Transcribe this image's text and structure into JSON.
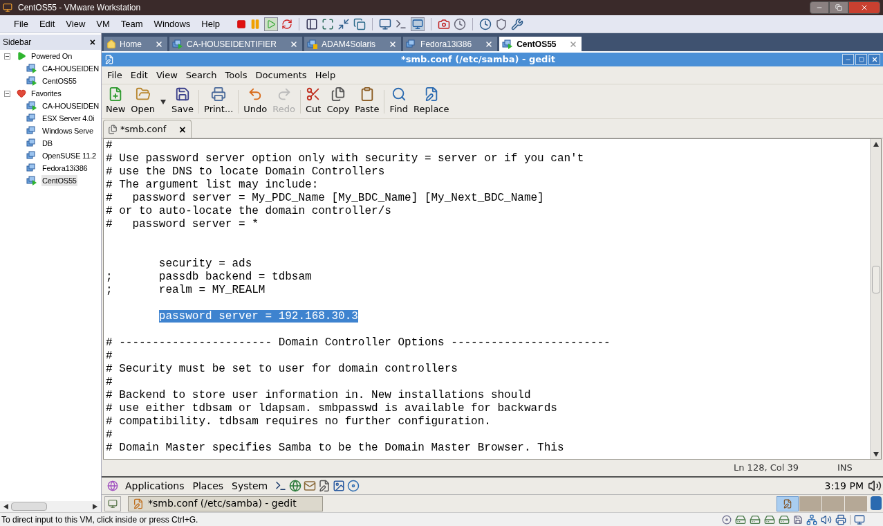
{
  "window": {
    "title": "CentOS55 - VMware Workstation"
  },
  "menu": [
    "File",
    "Edit",
    "View",
    "VM",
    "Team",
    "Windows",
    "Help"
  ],
  "sidebar": {
    "title": "Sidebar",
    "close": "×",
    "items": [
      {
        "label": "Powered On",
        "kind": "running",
        "expanded": true,
        "selected": false,
        "children": [
          {
            "label": "CA-HOUSEIDEN",
            "kind": "vm-on",
            "selected": false
          },
          {
            "label": "CentOS55",
            "kind": "vm-on",
            "selected": false
          }
        ]
      },
      {
        "label": "Favorites",
        "kind": "favorites",
        "expanded": true,
        "selected": false,
        "children": [
          {
            "label": "CA-HOUSEIDEN",
            "kind": "vm-on",
            "selected": false
          },
          {
            "label": "ESX Server 4.0i",
            "kind": "vm",
            "selected": false
          },
          {
            "label": "Windows Serve",
            "kind": "vm",
            "selected": false
          },
          {
            "label": "DB",
            "kind": "vm",
            "selected": false
          },
          {
            "label": "OpenSUSE 11.2",
            "kind": "vm",
            "selected": false
          },
          {
            "label": "Fedora13i386",
            "kind": "vm",
            "selected": false
          },
          {
            "label": "CentOS55",
            "kind": "vm-on",
            "selected": true
          }
        ]
      }
    ]
  },
  "tabs": [
    {
      "label": "Home",
      "kind": "home",
      "selected": false
    },
    {
      "label": "CA-HOUSEIDENTIFIER",
      "kind": "vm-on",
      "selected": false
    },
    {
      "label": "ADAM4Solaris",
      "kind": "vm-paused",
      "selected": false
    },
    {
      "label": "Fedora13i386",
      "kind": "vm",
      "selected": false
    },
    {
      "label": "CentOS55",
      "kind": "vm-on",
      "selected": true
    }
  ],
  "gedit": {
    "title": "*smb.conf (/etc/samba) - gedit",
    "menu": [
      "File",
      "Edit",
      "View",
      "Search",
      "Tools",
      "Documents",
      "Help"
    ],
    "toolbar": [
      {
        "label": "New",
        "kind": "new",
        "disabled": false
      },
      {
        "label": "Open",
        "kind": "open",
        "disabled": false
      },
      {
        "label": "Save",
        "kind": "save",
        "disabled": false
      },
      {
        "label": "Print...",
        "kind": "print",
        "disabled": false
      },
      {
        "label": "Undo",
        "kind": "undo",
        "disabled": false
      },
      {
        "label": "Redo",
        "kind": "redo",
        "disabled": true
      },
      {
        "label": "Cut",
        "kind": "cut",
        "disabled": false
      },
      {
        "label": "Copy",
        "kind": "copy",
        "disabled": false
      },
      {
        "label": "Paste",
        "kind": "paste",
        "disabled": false
      },
      {
        "label": "Find",
        "kind": "find",
        "disabled": false
      },
      {
        "label": "Replace",
        "kind": "replace",
        "disabled": false
      }
    ],
    "doc_tab": {
      "label": "*smb.conf",
      "close": "×"
    },
    "lines": [
      {
        "kind": "text",
        "text": "#",
        "selected": false
      },
      {
        "kind": "text",
        "text": "# Use password server option only with security = server or if you can't",
        "selected": false
      },
      {
        "kind": "text",
        "text": "# use the DNS to locate Domain Controllers",
        "selected": false
      },
      {
        "kind": "text",
        "text": "# The argument list may include:",
        "selected": false
      },
      {
        "kind": "text",
        "text": "#   password server = My_PDC_Name [My_BDC_Name] [My_Next_BDC_Name]",
        "selected": false
      },
      {
        "kind": "text",
        "text": "# or to auto-locate the domain controller/s",
        "selected": false
      },
      {
        "kind": "text",
        "text": "#   password server = *",
        "selected": false
      },
      {
        "kind": "blank"
      },
      {
        "kind": "blank"
      },
      {
        "kind": "text",
        "text": "        security = ads",
        "selected": false
      },
      {
        "kind": "text",
        "text": ";       passdb backend = tdbsam",
        "selected": false
      },
      {
        "kind": "text",
        "text": ";       realm = MY_REALM",
        "selected": false
      },
      {
        "kind": "blank"
      },
      {
        "kind": "text",
        "text": "        password server = 192.168.30.3",
        "selected": true
      },
      {
        "kind": "blank"
      },
      {
        "kind": "text",
        "text": "# ----------------------- Domain Controller Options ------------------------",
        "selected": false
      },
      {
        "kind": "text",
        "text": "#",
        "selected": false
      },
      {
        "kind": "text",
        "text": "# Security must be set to user for domain controllers",
        "selected": false
      },
      {
        "kind": "text",
        "text": "#",
        "selected": false
      },
      {
        "kind": "text",
        "text": "# Backend to store user information in. New installations should",
        "selected": false
      },
      {
        "kind": "text",
        "text": "# use either tdbsam or ldapsam. smbpasswd is available for backwards",
        "selected": false
      },
      {
        "kind": "text",
        "text": "# compatibility. tdbsam requires no further configuration.",
        "selected": false
      },
      {
        "kind": "text",
        "text": "#",
        "selected": false
      },
      {
        "kind": "text",
        "text": "# Domain Master specifies Samba to be the Domain Master Browser. This",
        "selected": false
      }
    ],
    "status": {
      "position": "Ln 128, Col 39",
      "mode": "INS"
    }
  },
  "gnome_panel": {
    "menus": [
      "Applications",
      "Places",
      "System"
    ],
    "clock": "3:19 PM"
  },
  "gnome_taskbar": {
    "window": "*smb.conf (/etc/samba) - gedit"
  },
  "status_bar": "To direct input to this VM, click inside or press Ctrl+G."
}
